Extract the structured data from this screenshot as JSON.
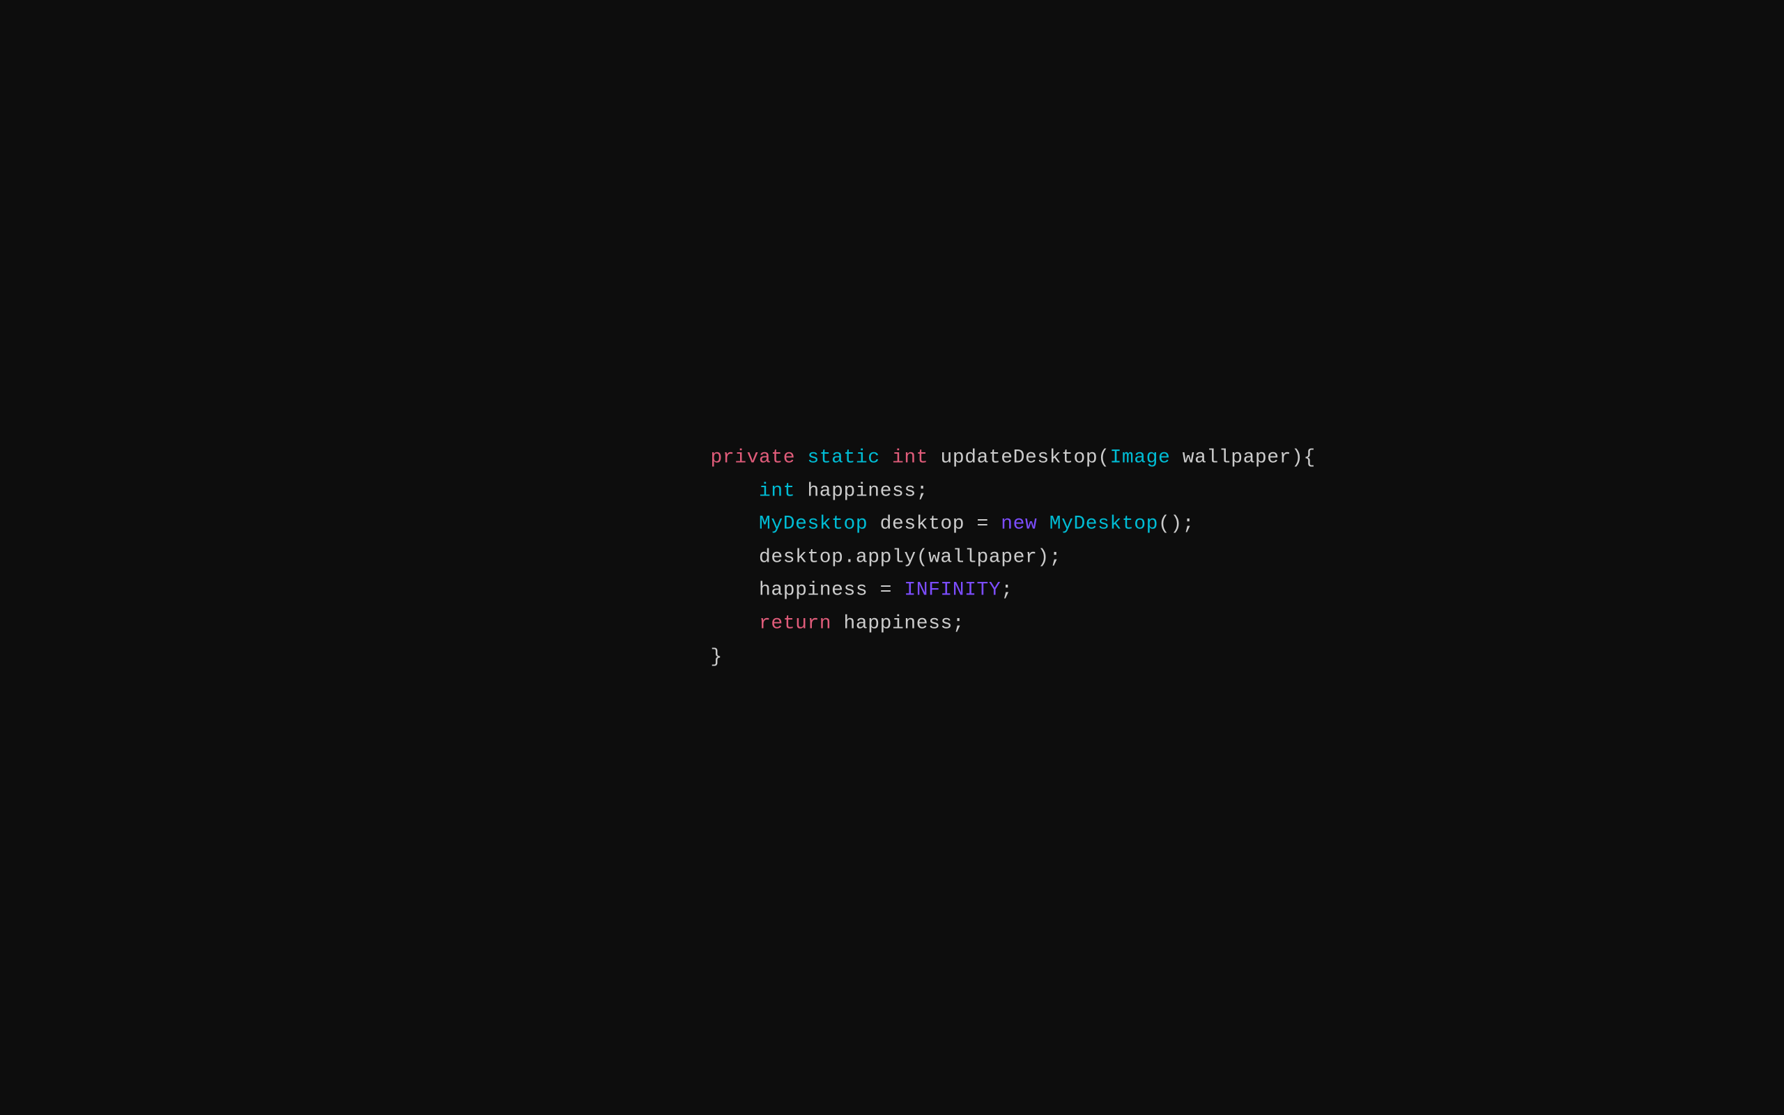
{
  "code": {
    "lines": [
      {
        "id": "line1",
        "segments": [
          {
            "text": "private",
            "class": "kw-private"
          },
          {
            "text": " ",
            "class": "plain"
          },
          {
            "text": "static",
            "class": "kw-static"
          },
          {
            "text": " ",
            "class": "plain"
          },
          {
            "text": "int",
            "class": "kw-int"
          },
          {
            "text": " updateDesktop(",
            "class": "plain"
          },
          {
            "text": "Image",
            "class": "kw-image"
          },
          {
            "text": " wallpaper){",
            "class": "plain"
          }
        ]
      },
      {
        "id": "line2",
        "segments": [
          {
            "text": "    ",
            "class": "plain"
          },
          {
            "text": "int",
            "class": "kw-int2"
          },
          {
            "text": " happiness;",
            "class": "plain"
          }
        ]
      },
      {
        "id": "line3",
        "segments": [
          {
            "text": "    ",
            "class": "plain"
          },
          {
            "text": "MyDesktop",
            "class": "kw-mydesktop"
          },
          {
            "text": " desktop = ",
            "class": "plain"
          },
          {
            "text": "new",
            "class": "kw-new"
          },
          {
            "text": " ",
            "class": "plain"
          },
          {
            "text": "MyDesktop",
            "class": "kw-mydesktop2"
          },
          {
            "text": "();",
            "class": "plain"
          }
        ]
      },
      {
        "id": "line4",
        "segments": [
          {
            "text": "    desktop.apply(wallpaper);",
            "class": "plain"
          }
        ]
      },
      {
        "id": "line5",
        "segments": [
          {
            "text": "    happiness = ",
            "class": "plain"
          },
          {
            "text": "INFINITY",
            "class": "kw-infinity"
          },
          {
            "text": ";",
            "class": "plain"
          }
        ]
      },
      {
        "id": "line6",
        "segments": [
          {
            "text": "    ",
            "class": "plain"
          },
          {
            "text": "return",
            "class": "kw-return"
          },
          {
            "text": " happiness;",
            "class": "plain"
          }
        ]
      },
      {
        "id": "line7",
        "segments": [
          {
            "text": "}",
            "class": "brace"
          }
        ]
      }
    ]
  }
}
